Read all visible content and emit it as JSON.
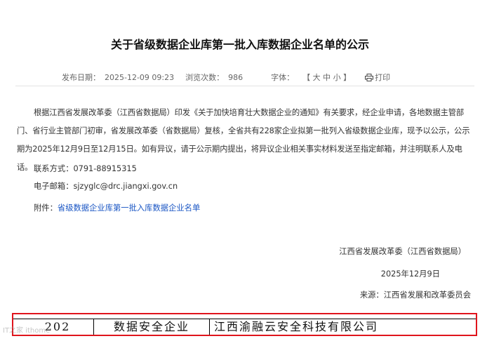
{
  "article": {
    "title": "关于省级数据企业库第一批入库数据企业名单的公示",
    "meta": {
      "publish_label": "发布日期：",
      "publish_value": "2025-12-09 09:23",
      "views_label": "浏览次数：",
      "views_value": "986",
      "font_label": "字体：",
      "font_open": "【",
      "font_large": "大",
      "font_medium": "中",
      "font_small": "小",
      "font_close": "】",
      "print_label": "打印",
      "print_icon": "printer-icon"
    },
    "body": "根据江西省发展改革委（江西省数据局）印发《关于加快培育壮大数据企业的通知》有关要求，经企业申请，各地数据主管部门、省行业主管部门初审，省发展改革委（省数据局）复核，全省共有228家企业拟第一批列入省级数据企业库，现予以公示，公示期为2025年12月9日至12月15日。如有异议，请于公示期内提出，将异议企业相关事实材料发送至指定邮箱，并注明联系人及电话。",
    "contact": "联系方式：0791-88915315",
    "email": "电子邮箱：sjzyglc@drc.jiangxi.gov.cn",
    "attachment_label": "附件：",
    "attachment_link": "省级数据企业库第一批入库数据企业名单",
    "signature": "江西省发展改革委（江西省数据局）",
    "date": "2025年12月9日",
    "source": "来源：江西省发展和改革委员会"
  },
  "table_row": {
    "number": "202",
    "category": "数据安全企业",
    "company": "江西渝融云安全科技有限公司"
  },
  "watermark": "IT之家 ithome",
  "colors": {
    "link": "#1a56c4",
    "highlight_border": "#e0141c"
  }
}
